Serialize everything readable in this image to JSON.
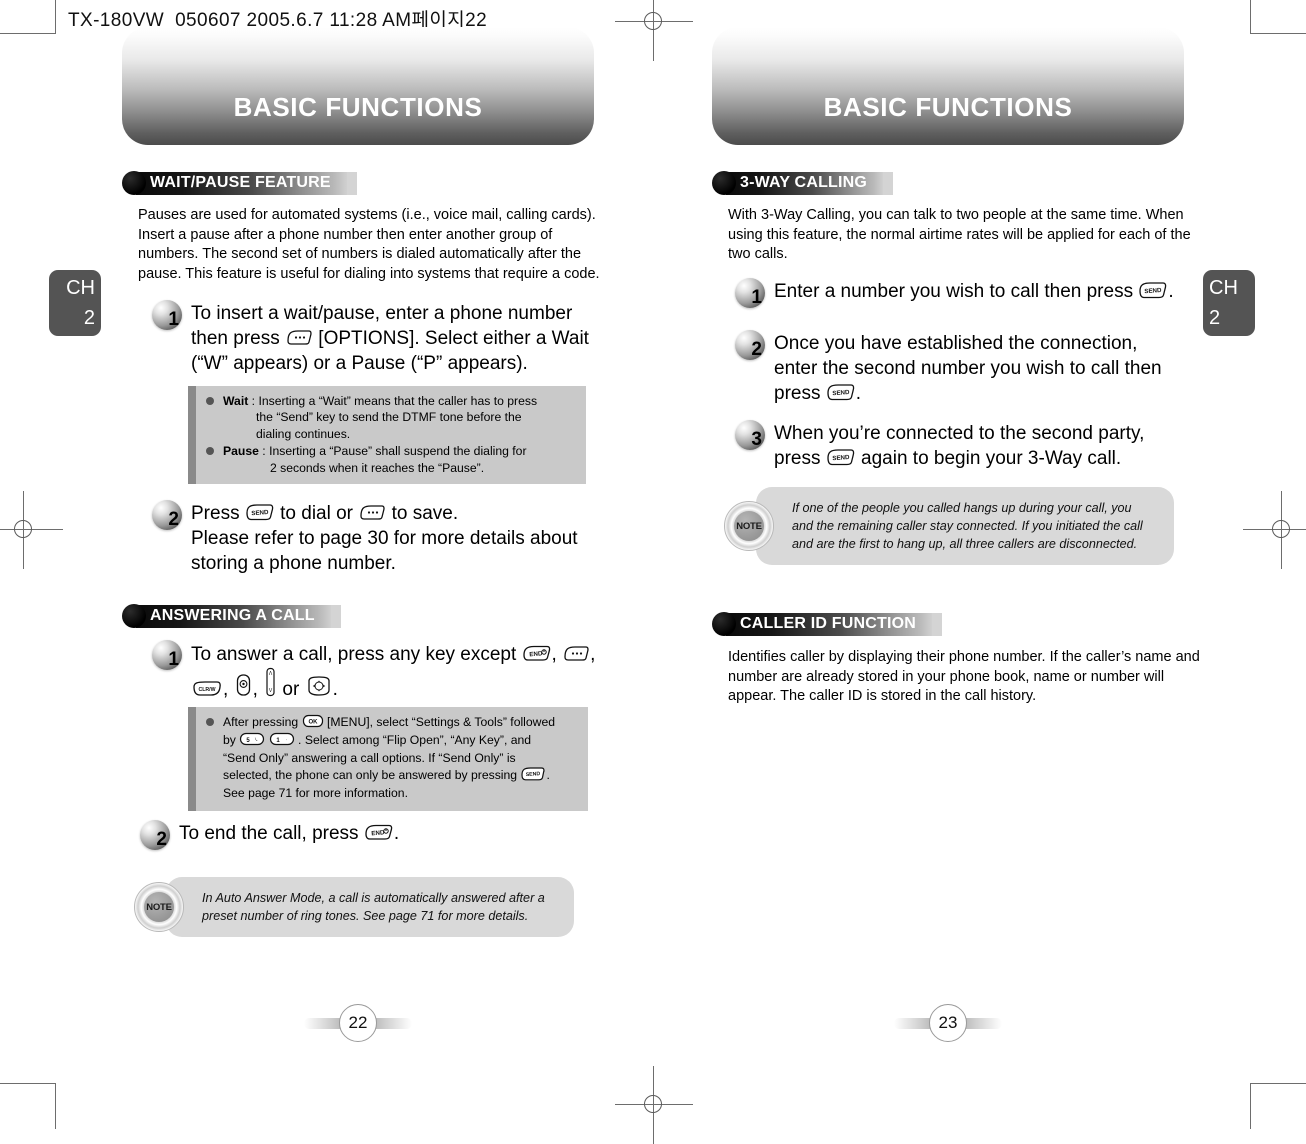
{
  "file_header": "TX-180VW_050607  2005.6.7 11:28 AM페이지22",
  "colors": {
    "banner_dark": "#4b4b4b",
    "section_bar_dark": "#0a0a0a",
    "infobox_bg": "#c9c9c9",
    "infobox_spine": "#8a8a8a",
    "note_bg": "#d9d9d9",
    "chapter_tab": "#545454"
  },
  "left_page": {
    "banner_title": "BASIC FUNCTIONS",
    "chapter_tab": {
      "line1": "CH",
      "line2": "2"
    },
    "page_number": "22",
    "sections": [
      {
        "heading": "WAIT/PAUSE FEATURE",
        "intro": "Pauses are used for automated systems (i.e., voice mail, calling cards). Insert a pause after a phone number then enter another group of numbers. The second set of numbers is dialed automatically after the pause. This feature is useful for dialing into systems that require a code.",
        "steps": [
          {
            "number": "1",
            "text_parts": [
              "To insert a wait/pause, enter a phone number then press ",
              " [OPTIONS]. Select either a Wait (“W” appears) or a Pause (“P” appears)."
            ],
            "key_icons": [
              "options-key"
            ]
          },
          {
            "number": "2",
            "text_parts": [
              "Press ",
              " to dial or ",
              " to save.",
              "Please refer to page 30 for more details about storing a phone number."
            ],
            "key_icons": [
              "send-key",
              "options-key"
            ]
          }
        ],
        "infobox": {
          "rows": [
            {
              "label": "Wait",
              "text": " : Inserting a “Wait” means that the caller has to press",
              "cont": [
                "the “Send” key to send the DTMF tone before the",
                "dialing continues."
              ]
            },
            {
              "label": "Pause",
              "text": " : Inserting a “Pause” shall suspend the dialing for",
              "cont": [
                "2 seconds when it reaches the “Pause”."
              ]
            }
          ]
        }
      },
      {
        "heading": "ANSWERING A CALL",
        "steps": [
          {
            "number": "1",
            "text_parts": [
              "To answer a call, press any key except ",
              " , ",
              " , ",
              ", ",
              " , ",
              " or ",
              " ."
            ],
            "key_icons": [
              "end-key",
              "options-key",
              "clr-key",
              "speaker-key",
              "volume-key",
              "navigation-key"
            ]
          },
          {
            "number": "2",
            "text_parts": [
              "To end the call, press ",
              " ."
            ],
            "key_icons": [
              "end-key"
            ]
          }
        ],
        "infobox": {
          "rows": [
            {
              "text_lines": [
                "After pressing [OK] [MENU], select “Settings & Tools” followed",
                "by [5] [1] . Select among “Flip Open”, “Any Key”, and",
                "“Send Only” answering a call options. If “Send Only” is",
                "selected, the phone can only be answered by pressing [SEND] .",
                "See page 71 for more information."
              ]
            }
          ]
        },
        "note": {
          "icon_label": "NOTE",
          "text": "In Auto Answer Mode, a call is automatically answered after a preset number of ring tones. See page 71 for more details."
        }
      }
    ]
  },
  "right_page": {
    "banner_title": "BASIC FUNCTIONS",
    "chapter_tab": {
      "line1": "CH",
      "line2": "2"
    },
    "page_number": "23",
    "sections": [
      {
        "heading": "3-WAY CALLING",
        "intro": "With 3-Way Calling, you can talk to two people at the same time. When using this feature, the normal airtime rates will be applied for each of the two calls.",
        "steps": [
          {
            "number": "1",
            "text_parts": [
              "Enter a number you wish to call then press ",
              " ."
            ],
            "key_icons": [
              "send-key"
            ]
          },
          {
            "number": "2",
            "text_parts": [
              "Once you have established the connection, enter the second number you wish to call then press ",
              " ."
            ],
            "key_icons": [
              "send-key"
            ]
          },
          {
            "number": "3",
            "text_parts": [
              "When you’re connected to the second party, press ",
              " again to begin your 3-Way call."
            ],
            "key_icons": [
              "send-key"
            ]
          }
        ],
        "note": {
          "icon_label": "NOTE",
          "text": "If one of the people you called hangs up during your call, you and the remaining caller stay connected. If you initiated the call and are the first to hang up, all three callers are disconnected."
        }
      },
      {
        "heading": "CALLER ID FUNCTION",
        "intro": "Identifies caller by displaying their phone number. If the caller’s name and number are already stored in your phone book, name or number will appear. The caller ID is stored in the call history."
      }
    ]
  },
  "step_text": {
    "l1s1_a": "To insert a wait/pause, enter a phone number",
    "l1s1_b": "then press",
    "l1s1_c": "[OPTIONS]. Select either a Wait",
    "l1s1_d": "(“W” appears) or a Pause (“P” appears).",
    "l1s2_a": "Press",
    "l1s2_b": "to dial or",
    "l1s2_c": "to save.",
    "l1s2_d": "Please refer to page 30 for more details about",
    "l1s2_e": "storing a phone number.",
    "l2s1_a": "To answer a call, press any key except",
    "l2s1_or": "or",
    "l2s2_a": "To end the call, press",
    "r1s1_a": "Enter a number you wish to call then press",
    "r1s2_a": "Once you have established the connection,",
    "r1s2_b": "enter the second number you wish to call then",
    "r1s2_c": "press",
    "r1s3_a": "When you’re connected to the second party,",
    "r1s3_b": "press",
    "r1s3_c": "again to begin your 3-Way call."
  },
  "infobox_text": {
    "wait_label": "Wait",
    "wait_l1": " : Inserting a “Wait” means that the caller has to press",
    "wait_l2": "the “Send” key to send the DTMF tone before the",
    "wait_l3": "dialing continues.",
    "pause_label": "Pause",
    "pause_l1": " : Inserting a “Pause” shall suspend the dialing for",
    "pause_l2": "2 seconds when it reaches the “Pause”.",
    "ans_l1a": "After pressing",
    "ans_l1b": "[MENU], select “Settings & Tools” followed",
    "ans_l2a": "by",
    "ans_l2b": ". Select among “Flip Open”, “Any Key”, and",
    "ans_l3": "“Send Only” answering a call options. If “Send Only” is",
    "ans_l4a": "selected, the phone can only be answered by pressing",
    "ans_l4b": ".",
    "ans_l5": "See page 71 for more information."
  },
  "key_labels": {
    "send": "SEND",
    "end": "END",
    "ok": "OK",
    "clr": "CLR/W",
    "five": "5",
    "one": "1"
  }
}
